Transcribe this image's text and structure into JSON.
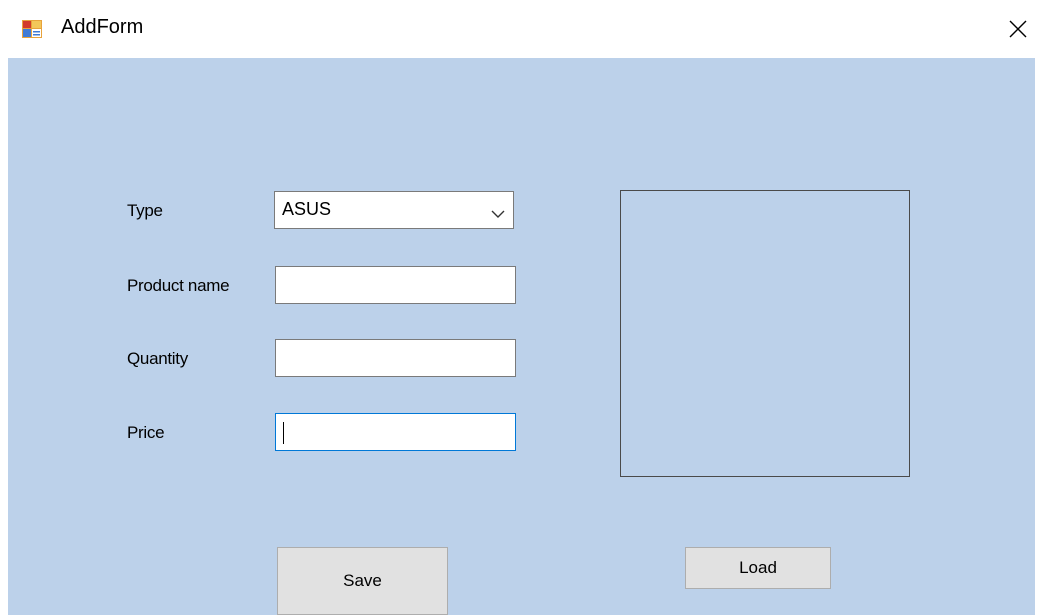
{
  "window": {
    "title": "AddForm",
    "icons": {
      "app": "form-app-icon",
      "close": "close-icon"
    }
  },
  "form": {
    "type_label": "Type",
    "type_value": "ASUS",
    "product_name_label": "Product name",
    "product_name_value": "",
    "quantity_label": "Quantity",
    "quantity_value": "",
    "price_label": "Price",
    "price_value": "",
    "focused_field": "price"
  },
  "buttons": {
    "save_label": "Save",
    "load_label": "Load"
  },
  "colors": {
    "form_background": "#bcd1ea",
    "focus_border": "#0078d7",
    "button_face": "#e1e1e1"
  }
}
